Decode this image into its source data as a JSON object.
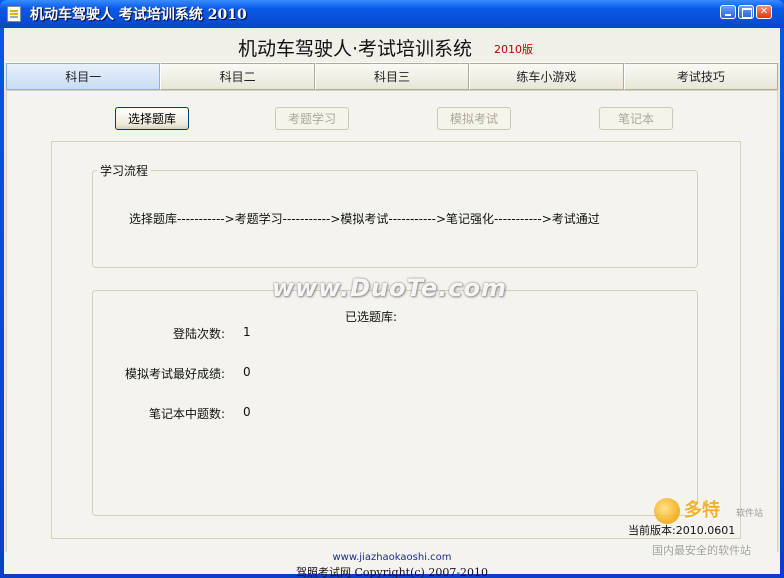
{
  "window": {
    "title": "机动车驾驶人 考试培训系统 2010"
  },
  "header": {
    "title": "机动车驾驶人·考试培训系统",
    "version": "2010版"
  },
  "tabs": [
    {
      "label": "科目一",
      "active": true
    },
    {
      "label": "科目二",
      "active": false
    },
    {
      "label": "科目三",
      "active": false
    },
    {
      "label": "练车小游戏",
      "active": false
    },
    {
      "label": "考试技巧",
      "active": false
    }
  ],
  "toolbar": {
    "select_bank": "选择题库",
    "study": "考题学习",
    "mock_exam": "模拟考试",
    "notebook": "笔记本"
  },
  "process": {
    "legend": "学习流程",
    "flow": "选择题库----------->考题学习----------->模拟考试----------->笔记强化----------->考试通过"
  },
  "stats": {
    "selected_bank_label": "已选题库:",
    "login_count_label": "登陆次数:",
    "login_count_value": "1",
    "best_score_label": "模拟考试最好成绩:",
    "best_score_value": "0",
    "notebook_count_label": "笔记本中题数:",
    "notebook_count_value": "0"
  },
  "current_version": "当前版本:2010.0601",
  "footer": {
    "url": "www.jiazhaokaoshi.com",
    "copyright": "驾照考试网 Copyright(c) 2007-2010"
  },
  "watermark": {
    "text": "www.DuoTe.com",
    "logo_main": "多特",
    "logo_sub": "软件站",
    "logo_slogan": "国内最安全的软件站"
  },
  "colors": {
    "titlebar": "#0a4fd8",
    "active_tab": "#c9dcf5",
    "version_red": "#c00000"
  }
}
